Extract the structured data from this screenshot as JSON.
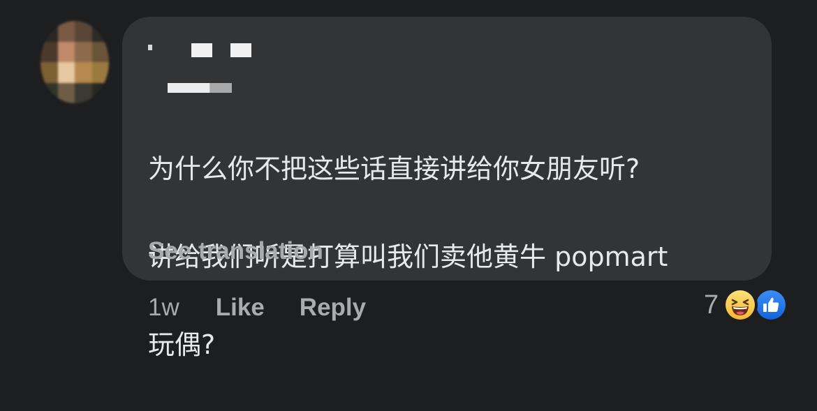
{
  "comment": {
    "author_name": "",
    "text_lines": [
      "为什么你不把这些话直接讲给你女朋友听?",
      "讲给我们听是打算叫我们卖他黄牛 popmart",
      "玩偶?"
    ],
    "translate_label": "See translation"
  },
  "meta": {
    "time": "1w",
    "like_label": "Like",
    "reply_label": "Reply"
  },
  "reactions": {
    "count": "7",
    "icons": [
      "haha-emoji-icon",
      "like-thumb-icon"
    ]
  },
  "colors": {
    "background": "#1d1e20",
    "bubble": "#333436",
    "text": "#e8e9ec",
    "secondary_text": "#a9abaf",
    "like_blue": "#1877f2",
    "haha_yellow": "#f7c53c"
  }
}
